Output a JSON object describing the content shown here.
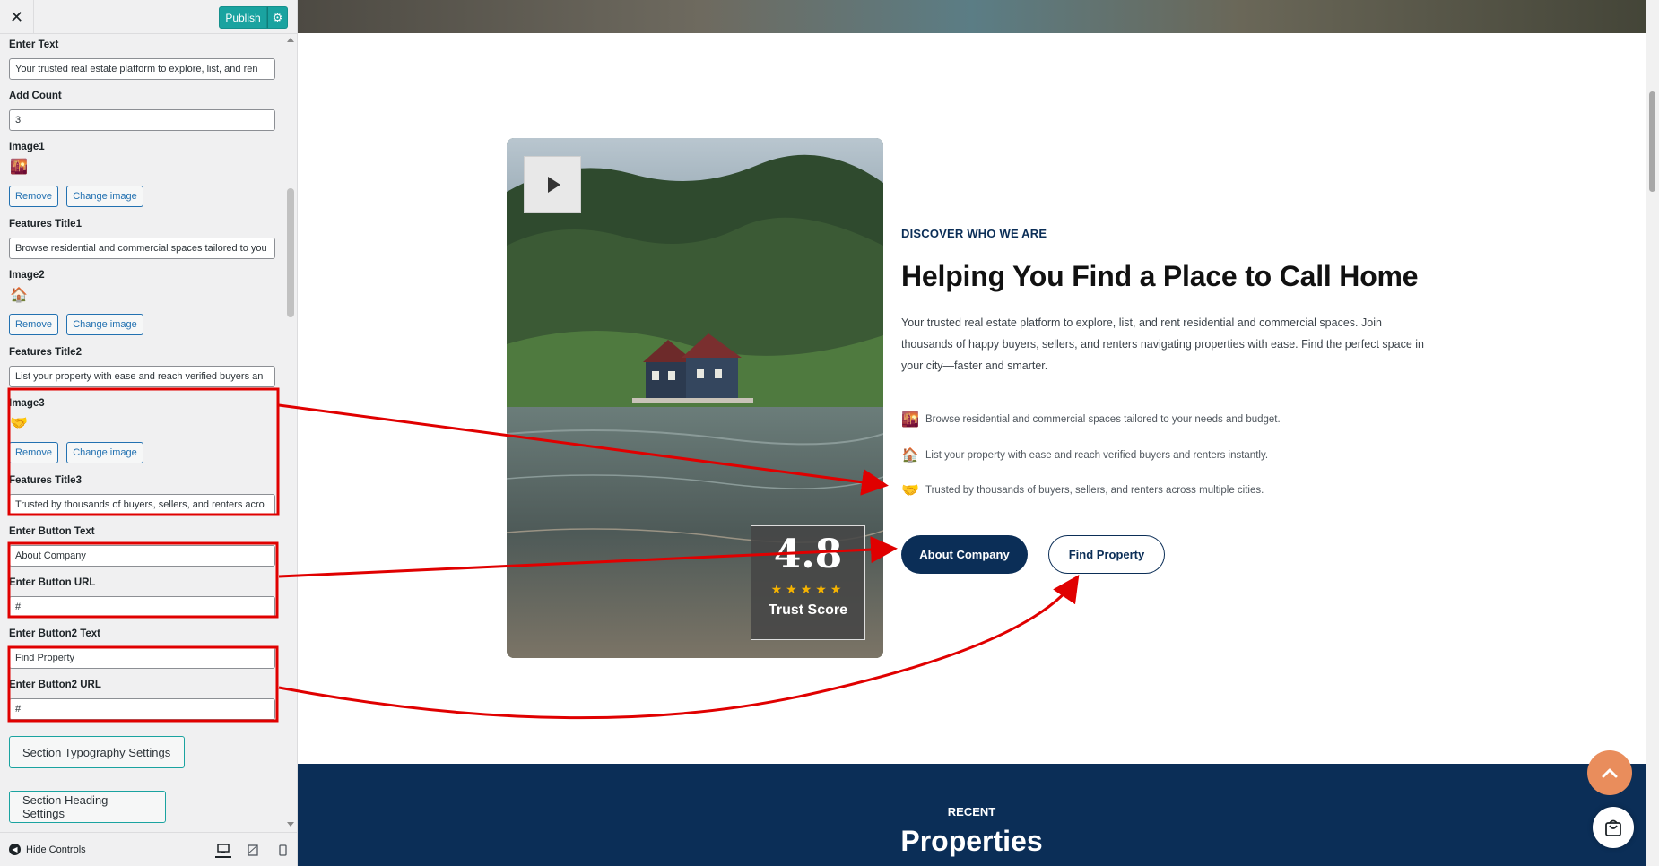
{
  "sidebar": {
    "publish_label": "Publish",
    "fields": {
      "enter_text_label": "Enter Text",
      "enter_text_value": "Your trusted real estate platform to explore, list, and ren",
      "add_count_label": "Add Count",
      "add_count_value": "3",
      "image1_label": "Image1",
      "features_title1_label": "Features Title1",
      "features_title1_value": "Browse residential and commercial spaces tailored to you",
      "image2_label": "Image2",
      "features_title2_label": "Features Title2",
      "features_title2_value": "List your property with ease and reach verified buyers an",
      "image3_label": "Image3",
      "features_title3_label": "Features Title3",
      "features_title3_value": "Trusted by thousands of buyers, sellers, and renters acro",
      "button_text_label": "Enter Button Text",
      "button_text_value": "About Company",
      "button_url_label": "Enter Button URL",
      "button_url_value": "#",
      "button2_text_label": "Enter Button2 Text",
      "button2_text_value": "Find Property",
      "button2_url_label": "Enter Button2 URL",
      "button2_url_value": "#"
    },
    "remove_label": "Remove",
    "change_image_label": "Change image",
    "typography_settings": "Section Typography Settings",
    "heading_settings": "Section Heading Settings",
    "hide_controls": "Hide Controls"
  },
  "preview": {
    "trust_score": "4.8",
    "trust_stars": "★★★★★",
    "trust_label": "Trust Score",
    "eyebrow": "DISCOVER WHO WE ARE",
    "heading": "Helping You Find a Place to Call Home",
    "description": "Your trusted real estate platform to explore, list, and rent residential and commercial spaces. Join thousands of happy buyers, sellers, and renters navigating properties with ease. Find the perfect space in your city—faster and smarter.",
    "features": [
      {
        "icon": "🌇",
        "text": "Browse residential and commercial spaces tailored to your needs and budget."
      },
      {
        "icon": "🏠",
        "text": "List your property with ease and reach verified buyers and renters instantly."
      },
      {
        "icon": "🤝",
        "text": "Trusted by thousands of buyers, sellers, and renters across multiple cities."
      }
    ],
    "button1": "About Company",
    "button2": "Find Property",
    "recent_eyebrow": "RECENT",
    "recent_title": "Properties"
  },
  "colors": {
    "navy": "#0b2e57",
    "teal": "#1aa3a0",
    "annotation_red": "#e00000",
    "back_to_top": "#e98d5c"
  }
}
